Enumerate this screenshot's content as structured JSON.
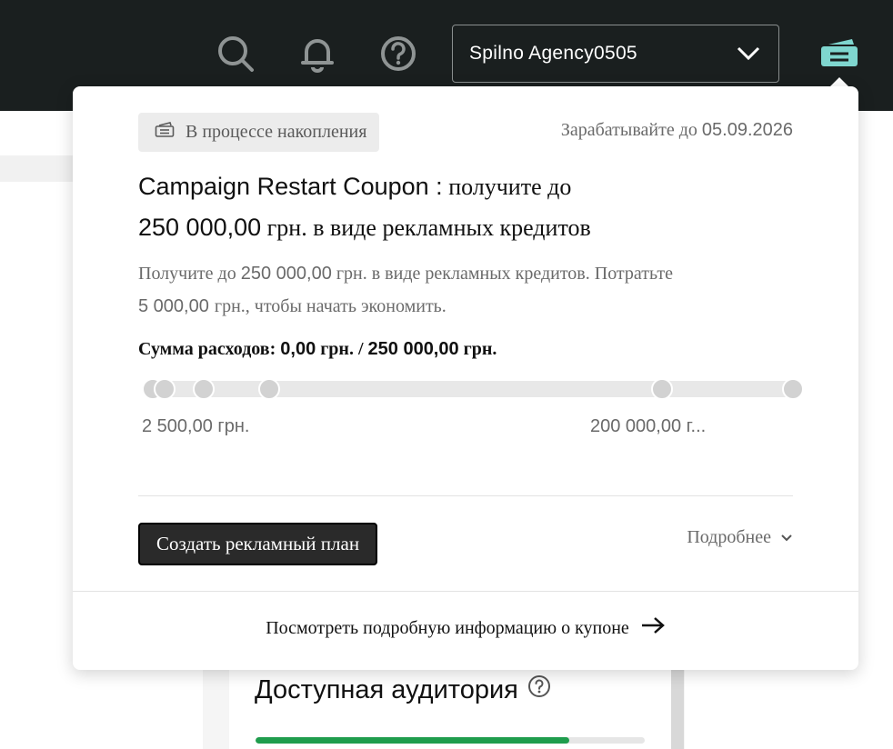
{
  "header": {
    "icons": [
      "search-icon",
      "bell-icon",
      "help-icon",
      "coupon-icon"
    ],
    "account_name": "Spilno Agency0505",
    "colors": {
      "topbar": "#1a1f1f",
      "coupon_accent": "#7fd6cf"
    }
  },
  "coupon": {
    "status_label": "В процессе накопления",
    "deadline_prefix": "Зарабатывайте до",
    "deadline_date": "05.09.2026",
    "title_name": "Campaign Restart Coupon :",
    "title_mid": "получите до",
    "title_amount": "250 000,00",
    "title_rest": "грн. в виде рекламных кредитов",
    "desc_1": "Получите до",
    "desc_amount": "250 000,00",
    "desc_2": "грн. в виде рекламных кредитов. Потратьте",
    "desc_spend": "5 000,00",
    "desc_3": "грн., чтобы начать экономить.",
    "spend_label": "Сумма расходов:",
    "spend_current": "0,00",
    "spend_current_unit": "грн. /",
    "spend_total": "250 000,00",
    "spend_total_unit": "грн.",
    "milestone_first_label": "2 500,00 грн.",
    "milestone_last_label": "200 000,00 г...",
    "progress_fraction": 0,
    "create_button": "Создать рекламный план",
    "more_link": "Подробнее",
    "details_link": "Посмотреть подробную информацию о купоне"
  },
  "background": {
    "audience_title": "Доступная аудитория",
    "audience_fill_fraction": 0.805,
    "colors": {
      "audience_fill": "#1f9d4d"
    }
  }
}
